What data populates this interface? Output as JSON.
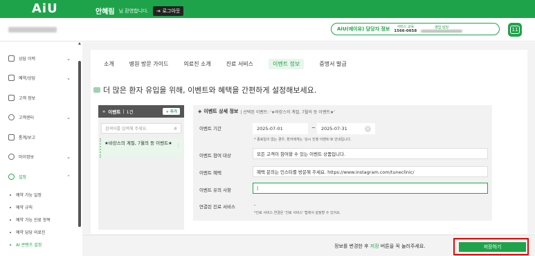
{
  "app": {
    "logo": "AiU",
    "user_name": "안혜림",
    "greeting": "님 환영합니다.",
    "logout": "로그아웃"
  },
  "header": {
    "manager_label": "AiU(에이유) 담당자 정보",
    "service_label": "서비스 교육",
    "service_phone": "1566-0658",
    "sales_label": "영업 담당",
    "calendar_label": "11"
  },
  "sidebar": {
    "items": [
      {
        "label": "상담 이력",
        "icon": "chat-icon"
      },
      {
        "label": "예약/상담",
        "icon": "calendar-icon"
      },
      {
        "label": "고객 정보",
        "icon": "person-icon"
      },
      {
        "label": "고객센터",
        "icon": "headset-icon"
      },
      {
        "label": "통계/보고",
        "icon": "chart-icon"
      },
      {
        "label": "마이정보",
        "icon": "user-icon"
      },
      {
        "label": "설정",
        "icon": "gear-icon"
      }
    ],
    "sub_items": [
      "예약 가능 일정",
      "예약 규칙",
      "예약 가능 진료 항목",
      "예약 담당 의료진",
      "AI 콘텐츠 설정"
    ]
  },
  "tabs": [
    "소개",
    "병원 방문 가이드",
    "의료진 소개",
    "진료 서비스",
    "이벤트 정보",
    "증명서 발급"
  ],
  "active_tab": "이벤트 정보",
  "headline": "더 많은 환자 유입을 위해, 이벤트와 혜택을 간편하게 설정해보세요.",
  "event_list": {
    "title": "이벤트",
    "count": "1건",
    "add_label": "+ 추가",
    "search_placeholder": "검색어를 입력해 주세요.",
    "items": [
      "★바캉스의 계절, 7월의 등 이벤트★"
    ]
  },
  "detail": {
    "title": "이벤트 상세 정보",
    "selected_prefix": "| 선택된 이벤트: '★바캉스의 계절, 7월의 등 이벤트★'",
    "period_label": "이벤트 기간",
    "start_date": "2025-07-01",
    "tilde": "~",
    "end_date": "2025-07-31",
    "period_note": "* 종료일이 없는 경우, 환자에게는 '상시 진행 이벤트'로 안내됩니다.",
    "target_label": "이벤트 참여 대상",
    "target_value": "모든 고객이 참여할 수 있는 이벤트 상품입니다.",
    "benefit_label": "이벤트 혜택",
    "benefit_value": "혜택 문의는 인스타를 방문해 주세요. https://www.instagram.com/tuneclinic/",
    "caution_label": "이벤트 유의 사항",
    "caution_value": "",
    "service_label": "연결된 진료 서비스",
    "service_value": "-",
    "service_note": "*진료 서비스 연결은 '진료 서비스' 탭에서 설정할 수 있어요."
  },
  "footer": {
    "text_pre": "정보를 변경한 후 ",
    "text_hl": "저장",
    "text_post": " 버튼을 꼭 눌러주세요.",
    "save_label": "저장하기"
  },
  "colors": {
    "accent": "#1ea34a",
    "highlight_box": "#e00000"
  }
}
